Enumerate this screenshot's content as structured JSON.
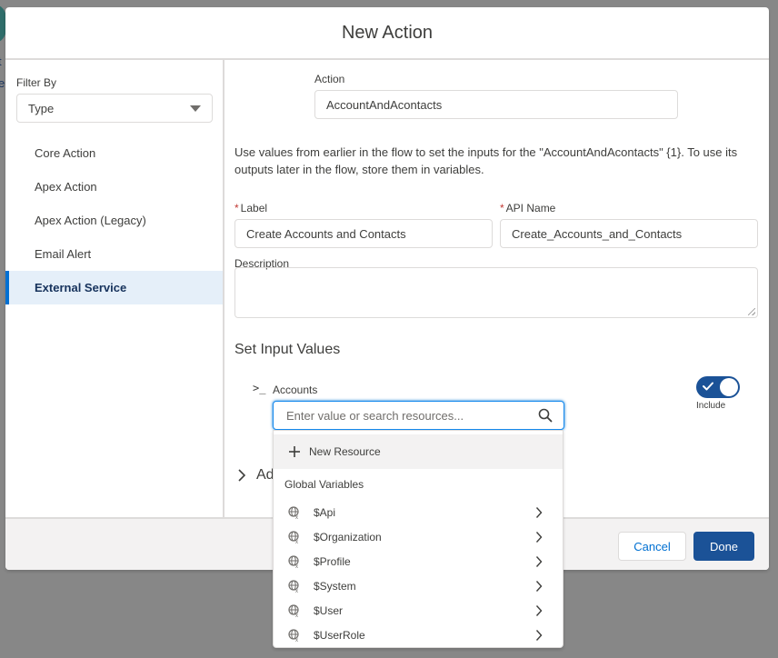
{
  "background": {
    "letters": [
      "t",
      "e"
    ]
  },
  "modal": {
    "title": "New Action"
  },
  "sidebar": {
    "filter_label": "Filter By",
    "filter_value": "Type",
    "items": [
      {
        "label": "Core Action",
        "active": false
      },
      {
        "label": "Apex Action",
        "active": false
      },
      {
        "label": "Apex Action (Legacy)",
        "active": false
      },
      {
        "label": "Email Alert",
        "active": false
      },
      {
        "label": "External Service",
        "active": true
      }
    ]
  },
  "form": {
    "action_label": "Action",
    "action_value": "AccountAndAcontacts",
    "help_text": "Use values from earlier in the flow to set the inputs for the \"AccountAndAcontacts\" {1}. To use its outputs later in the flow, store them in variables.",
    "label_label": "Label",
    "label_value": "Create Accounts and Contacts",
    "api_name_label": "API Name",
    "api_name_value": "Create_Accounts_and_Contacts",
    "required_marker": "*",
    "description_label": "Description",
    "description_value": "",
    "set_input_title": "Set Input Values",
    "param_icon": ">_",
    "param_label": "Accounts",
    "search_placeholder": "Enter value or search resources...",
    "include_label": "Include",
    "include_on": true,
    "advanced_label": "Ad"
  },
  "dropdown": {
    "new_resource_label": "New Resource",
    "group_label": "Global Variables",
    "items": [
      {
        "label": "$Api"
      },
      {
        "label": "$Organization"
      },
      {
        "label": "$Profile"
      },
      {
        "label": "$System"
      },
      {
        "label": "$User"
      },
      {
        "label": "$UserRole"
      }
    ]
  },
  "footer": {
    "cancel_label": "Cancel",
    "done_label": "Done"
  },
  "colors": {
    "brand": "#1b5297",
    "link": "#0070d2",
    "active_nav_bg": "#e5eff9",
    "required": "#c23934",
    "overlay": "#878787"
  }
}
